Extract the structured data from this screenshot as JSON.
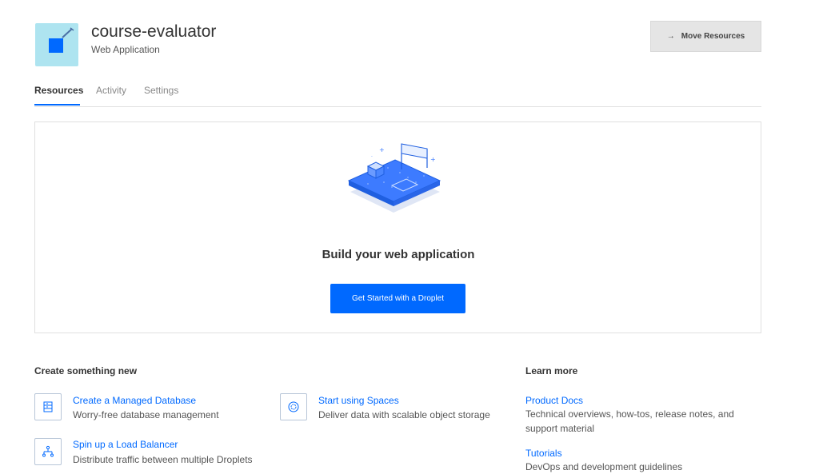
{
  "project": {
    "name": "course-evaluator",
    "type": "Web Application",
    "move_button": "Move Resources"
  },
  "tabs": [
    {
      "label": "Resources"
    },
    {
      "label": "Activity"
    },
    {
      "label": "Settings"
    }
  ],
  "empty_state": {
    "title": "Build your web application",
    "cta": "Get Started with a Droplet"
  },
  "create": {
    "heading": "Create something new",
    "items": [
      {
        "title": "Create a Managed Database",
        "desc": "Worry-free database management",
        "icon": "database-icon"
      },
      {
        "title": "Start using Spaces",
        "desc": "Deliver data with scalable object storage",
        "icon": "spaces-icon"
      },
      {
        "title": "Spin up a Load Balancer",
        "desc": "Distribute traffic between multiple Droplets",
        "icon": "load-balancer-icon"
      }
    ]
  },
  "learn": {
    "heading": "Learn more",
    "items": [
      {
        "title": "Product Docs",
        "desc": "Technical overviews, how-tos, release notes, and support material"
      },
      {
        "title": "Tutorials",
        "desc": "DevOps and development guidelines"
      }
    ]
  },
  "colors": {
    "accent": "#0069ff",
    "icon_bg": "#aee4f0"
  }
}
